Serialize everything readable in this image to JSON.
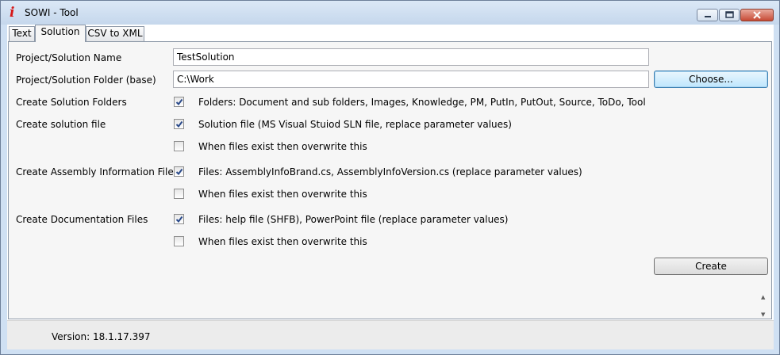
{
  "window": {
    "title": "SOWI - Tool",
    "icon": "info-i-icon"
  },
  "tabs": [
    {
      "label": "Text",
      "active": false
    },
    {
      "label": "Solution",
      "active": true
    },
    {
      "label": "CSV to XML",
      "active": false
    }
  ],
  "form": {
    "name_label": "Project/Solution Name",
    "name_value": "TestSolution",
    "folder_label": "Project/Solution Folder (base)",
    "folder_value": "C:\\Work",
    "choose_button": "Choose...",
    "rows": [
      {
        "label": "Create Solution Folders",
        "checks": [
          {
            "text": "Folders: Document and sub folders, Images, Knowledge, PM, PutIn, PutOut, Source, ToDo, Tool",
            "checked": true
          }
        ]
      },
      {
        "label": "Create solution file",
        "checks": [
          {
            "text": "Solution file (MS Visual Stuiod SLN file, replace parameter values)",
            "checked": true
          },
          {
            "text": "When files exist then overwrite this",
            "checked": false
          }
        ]
      },
      {
        "label": "Create Assembly Information Files",
        "checks": [
          {
            "text": "Files: AssemblyInfoBrand.cs, AssemblyInfoVersion.cs (replace parameter values)",
            "checked": true
          },
          {
            "text": "When files exist then overwrite this",
            "checked": false
          }
        ]
      },
      {
        "label": "Create Documentation Files",
        "checks": [
          {
            "text": "Files: help file (SHFB), PowerPoint file (replace parameter values)",
            "checked": true
          },
          {
            "text": "When files exist then overwrite this",
            "checked": false
          }
        ]
      }
    ],
    "create_button": "Create"
  },
  "status": {
    "version": "Version: 18.1.17.397"
  }
}
